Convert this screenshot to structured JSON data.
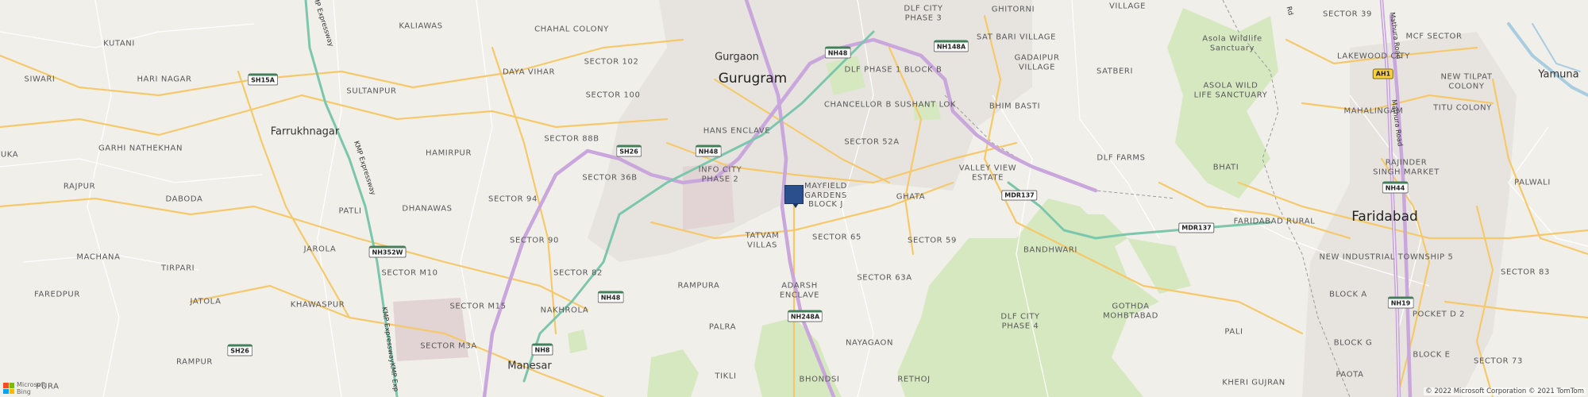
{
  "map": {
    "copyright": "© 2022 Microsoft Corporation © 2021 TomTom",
    "logo": {
      "line1": "Microsoft",
      "line2": "Bing"
    },
    "colors": {
      "land": "#f1efea",
      "park": "#d6e8c0",
      "highway": "#c9a6dc",
      "expressway": "#7cc6ad",
      "main_road": "#f5c96b",
      "river": "#a9cde0",
      "marker": "#2b4f8c"
    },
    "labels": {
      "l01": "KUTANI",
      "l02": "HARI NAGAR",
      "l03": "SIWARI",
      "l04": "KALIAWAS",
      "l05": "CHAHAL COLONY",
      "l06": "SECTOR 102",
      "l07": "DAYA VIHAR",
      "l08": "SECTOR 100",
      "l09": "SULTANPUR",
      "l10": "SECTOR 88B",
      "l11": "GARHI NATHEKHAN",
      "l12": "HAMIRPUR",
      "l13": "SECTOR 36B",
      "l14": "RAJPUR",
      "l15": "DABODA",
      "l16": "PATLI",
      "l17": "DHANAWAS",
      "l18": "SECTOR 94",
      "l19": "SECTOR 90",
      "l20": "JAROLA",
      "l21": "MACHANA",
      "l22": "TIRPARI",
      "l23": "SECTOR M10",
      "l24": "SECTOR 82",
      "l25": "FAREDPUR",
      "l26": "KHAWASPUR",
      "l27": "JATOLA",
      "l28": "SECTOR M15",
      "l29": "NAKHROLA",
      "l30": "RAMPURA",
      "l31": "SECTOR M3A",
      "l32": "RAMPUR",
      "l33": "HANS ENCLAVE",
      "l34": "INFO CITY\nPHASE 2",
      "l35": "MAYFIELD\nGARDENS\nBLOCK J",
      "l36": "TATVAM\nVILLAS",
      "l37": "SECTOR 65",
      "l38": "SECTOR 59",
      "l39": "SECTOR 52A",
      "l40": "CHANCELLOR B SUSHANT LOK",
      "l41": "DLF PHASE 1 BLOCK B",
      "l42": "DLF CITY\nPHASE 3",
      "l43": "GHITORNI",
      "l44": "SAT BARI VILLAGE",
      "l45": "GADAIPUR\nVILLAGE",
      "l46": "SATBERI",
      "l47": "BHIM BASTI",
      "l48": "VALLEY VIEW\nESTATE",
      "l49": "GHATA",
      "l50": "BANDHWARI",
      "l51": "SECTOR 63A",
      "l52": "ADARSH\nENCLAVE",
      "l53": "PALRA",
      "l54": "NAYAGAON",
      "l55": "DLF CITY\nPHASE 4",
      "l56": "GOTHDA\nMOHBTABAD",
      "l57": "PALI",
      "l58": "KHERI GUJRAN",
      "l59": "TIKLI",
      "l60": "BHONDSI",
      "l61": "RETHOJ",
      "l62": "DLF FARMS",
      "l63": "BHATI",
      "l64": "ASOLA WILD\nLIFE SANCTUARY",
      "l65": "Asola Wildlife\nSanctuary",
      "l66": "LAKEWOOD CITY",
      "l67": "MAHALINGAM",
      "l68": "SECTOR 39",
      "l69": "MCF SECTOR",
      "l70": "NEW TILPAT\nCOLONY",
      "l71": "TITU COLONY",
      "l72": "RAJINDER\nSINGH MARKET",
      "l73": "PALWALI",
      "l74": "FARIDABAD RURAL",
      "l75": "NEW INDUSTRIAL TOWNSHIP 5",
      "l76": "SECTOR 83",
      "l77": "BLOCK A",
      "l78": "POCKET D 2",
      "l79": "BLOCK G",
      "l80": "BLOCK E",
      "l81": "SECTOR 73",
      "l82": "PAOTA",
      "l83": "VILLAGE",
      "l84": "UKA",
      "l85": "PURA",
      "l86": "Gurgaon",
      "l87": "Gurugram",
      "l88": "Farrukhnagar",
      "l89": "Manesar",
      "l90": "Faridabad",
      "l91": "Yamuna",
      "l92": "KMP Expressway",
      "l93": "KMP Expressway",
      "l94": "KMP ExpresswayKMP Exp",
      "l95": "Mathura Road",
      "l96": "Mathura Road",
      "l97": "Rd"
    },
    "shields": {
      "s01": "NH48",
      "s02": "NH148A",
      "s03": "SH15A",
      "s04": "SH26",
      "s05": "NH48",
      "s06": "NH352W",
      "s07": "NH48",
      "s08": "NH8",
      "s09": "SH26",
      "s10": "NH248A",
      "s11": "MDR137",
      "s12": "MDR137",
      "s13": "AH1",
      "s14": "NH44",
      "s15": "NH19"
    }
  }
}
